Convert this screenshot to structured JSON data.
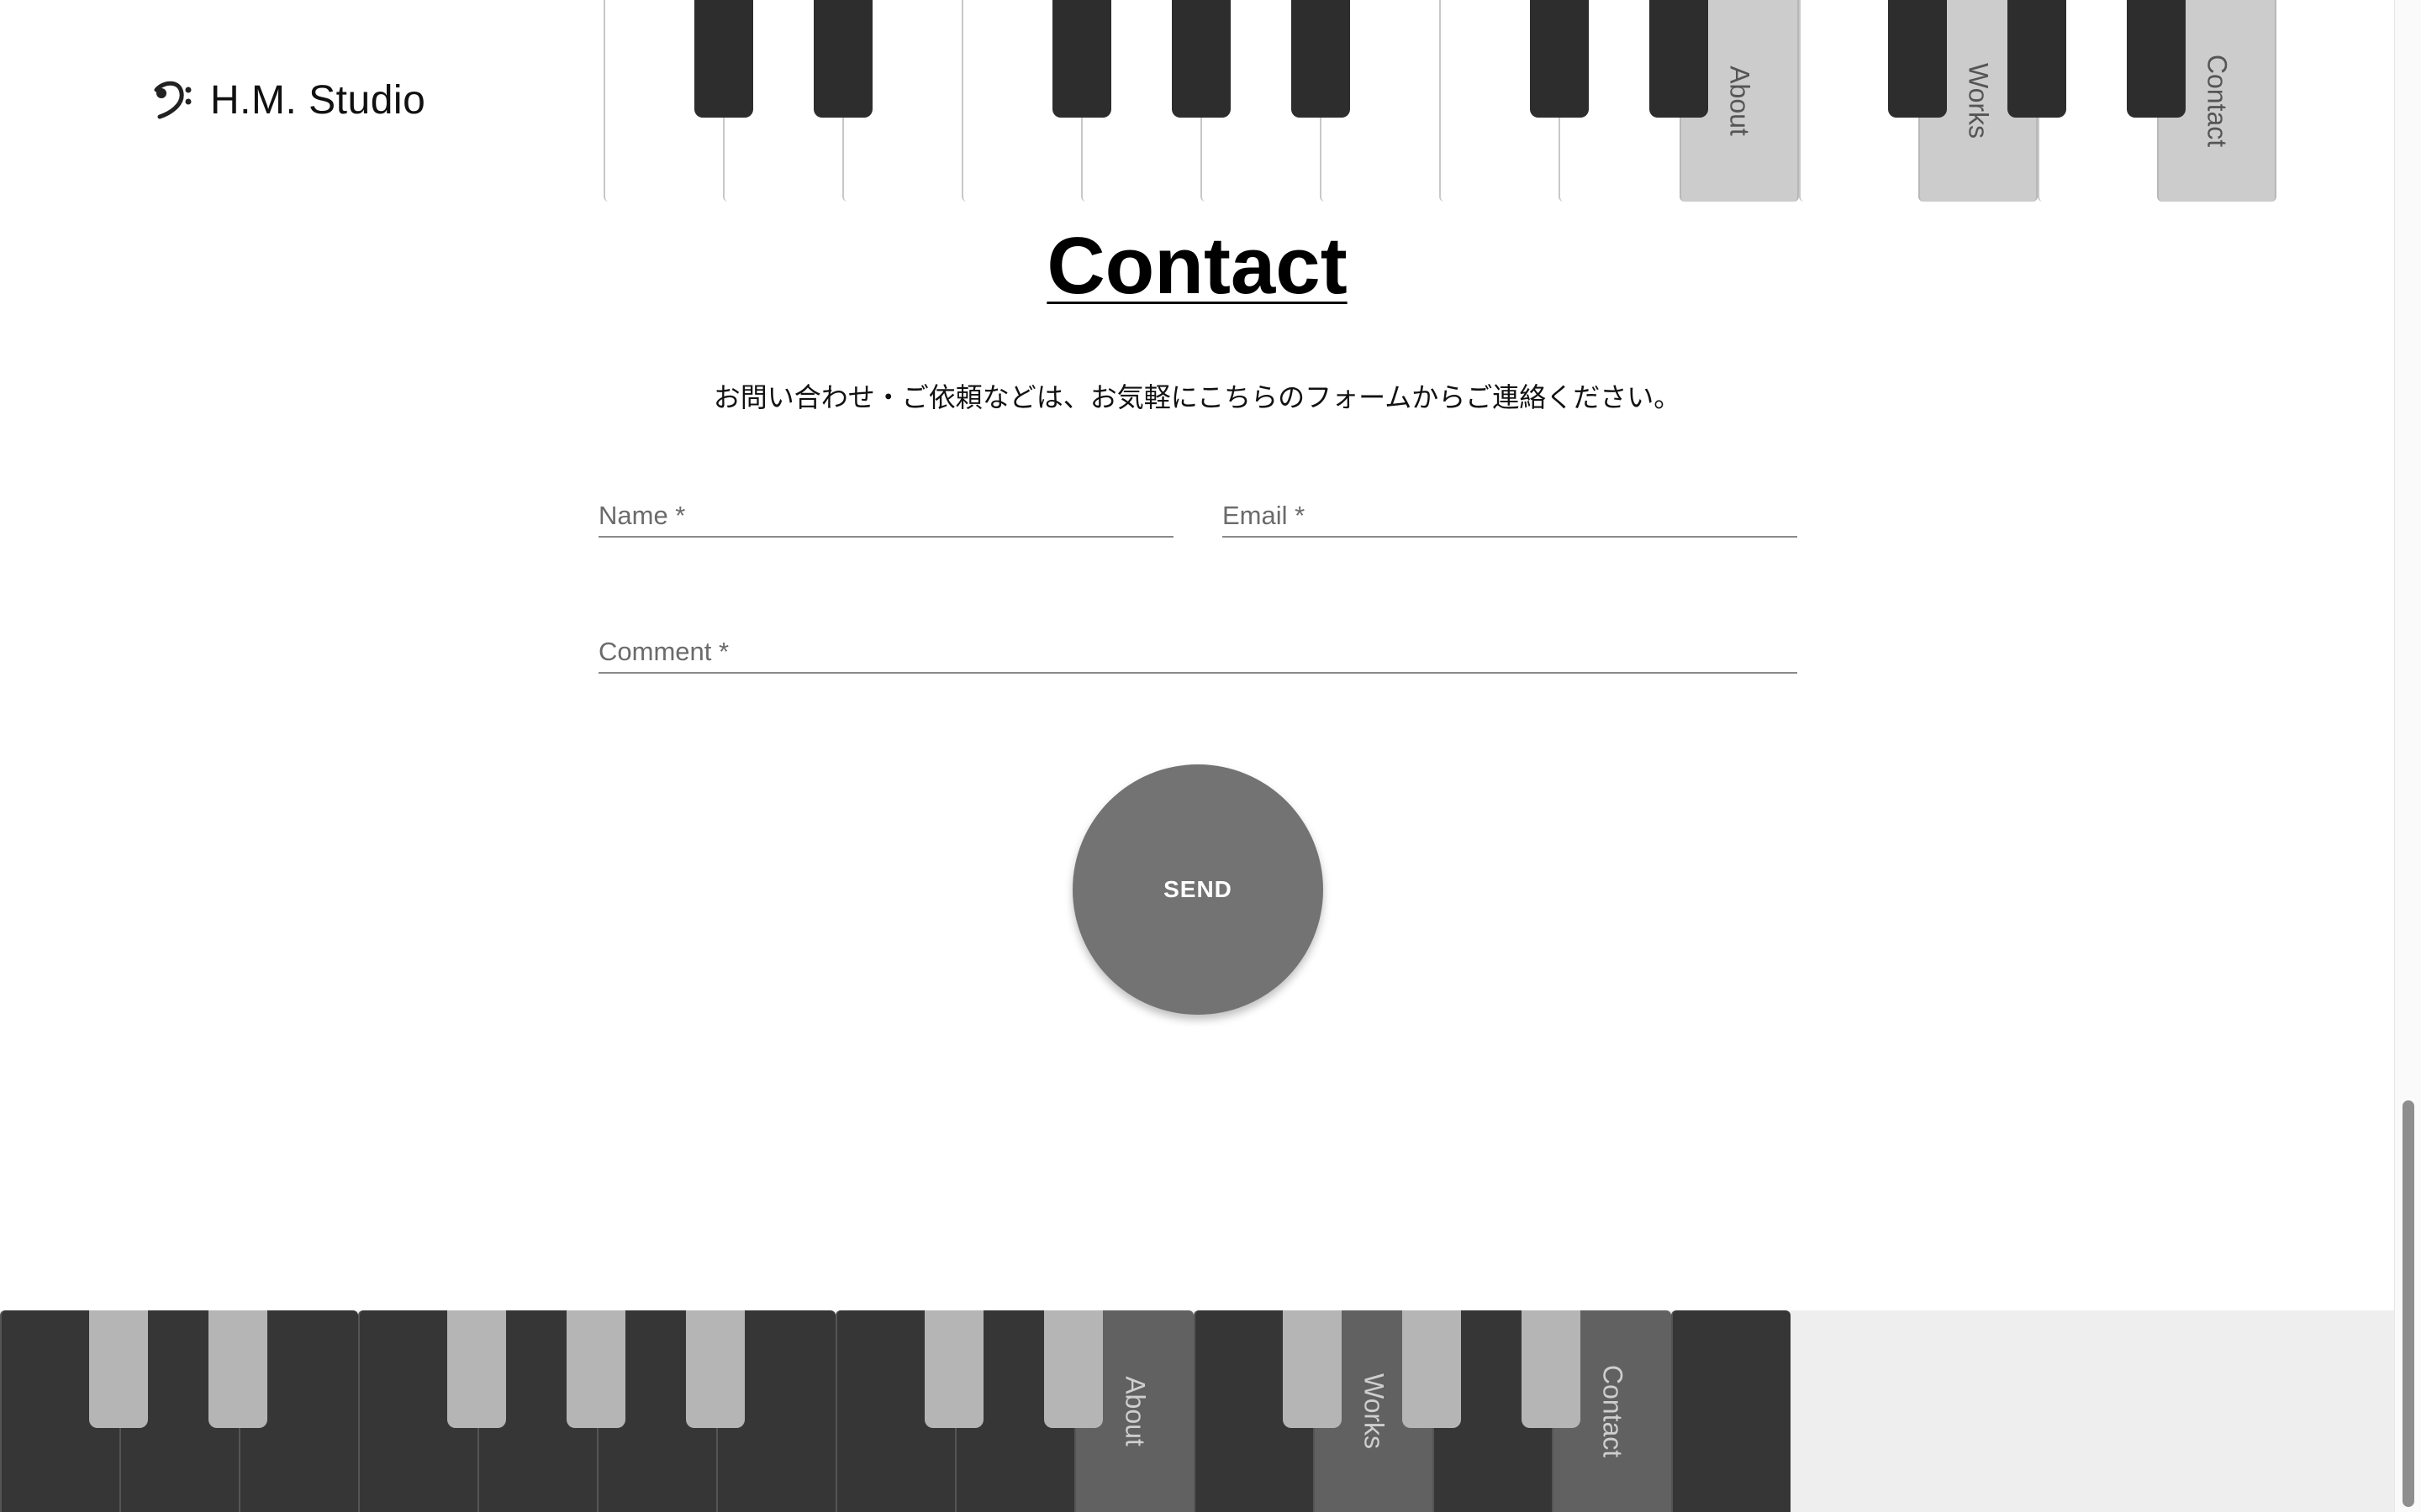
{
  "header": {
    "brand": "H.M. Studio",
    "logo_icon": "bass-clef-icon",
    "nav": {
      "about": "About",
      "works": "Works",
      "contact": "Contact"
    }
  },
  "main": {
    "title": "Contact",
    "intro": "お問い合わせ・ご依頼などは、お気軽にこちらのフォームからご連絡ください。",
    "form": {
      "name_placeholder": "Name *",
      "email_placeholder": "Email *",
      "comment_placeholder": "Comment *",
      "send_label": "SEND"
    }
  },
  "footer": {
    "nav": {
      "about": "About",
      "works": "Works",
      "contact": "Contact"
    }
  },
  "colors": {
    "nav_key_top": "#cccccc",
    "black_key": "#2d2d2d",
    "send_button": "#737373",
    "footer_white_key": "#363636",
    "footer_nav_key": "#616161",
    "footer_black_key": "#b5b5b5"
  }
}
